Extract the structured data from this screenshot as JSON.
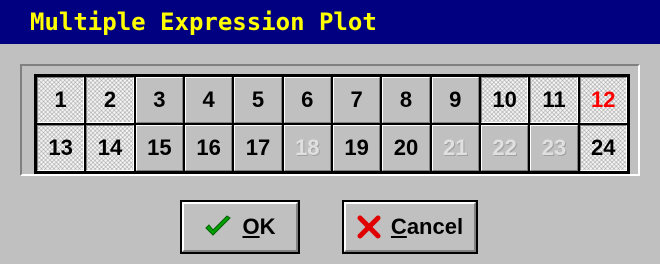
{
  "window": {
    "title": "Multiple Expression Plot"
  },
  "grid": {
    "rows": [
      [
        {
          "label": "1",
          "state": "selected"
        },
        {
          "label": "2",
          "state": "selected"
        },
        {
          "label": "3",
          "state": "normal"
        },
        {
          "label": "4",
          "state": "normal"
        },
        {
          "label": "5",
          "state": "normal"
        },
        {
          "label": "6",
          "state": "normal"
        },
        {
          "label": "7",
          "state": "normal"
        },
        {
          "label": "8",
          "state": "normal"
        },
        {
          "label": "9",
          "state": "normal"
        },
        {
          "label": "10",
          "state": "selected"
        },
        {
          "label": "11",
          "state": "selected"
        },
        {
          "label": "12",
          "state": "selected",
          "color": "#ff0000"
        }
      ],
      [
        {
          "label": "13",
          "state": "selected"
        },
        {
          "label": "14",
          "state": "selected"
        },
        {
          "label": "15",
          "state": "normal"
        },
        {
          "label": "16",
          "state": "normal"
        },
        {
          "label": "17",
          "state": "normal"
        },
        {
          "label": "18",
          "state": "disabled"
        },
        {
          "label": "19",
          "state": "normal"
        },
        {
          "label": "20",
          "state": "normal"
        },
        {
          "label": "21",
          "state": "disabled"
        },
        {
          "label": "22",
          "state": "disabled"
        },
        {
          "label": "23",
          "state": "disabled"
        },
        {
          "label": "24",
          "state": "selected"
        }
      ]
    ]
  },
  "buttons": {
    "ok": {
      "mnemonic": "O",
      "rest": "K",
      "icon": "checkmark-icon",
      "icon_color": "#00a000"
    },
    "cancel": {
      "mnemonic": "C",
      "rest": "ancel",
      "icon": "x-icon",
      "icon_color": "#e00000"
    }
  }
}
